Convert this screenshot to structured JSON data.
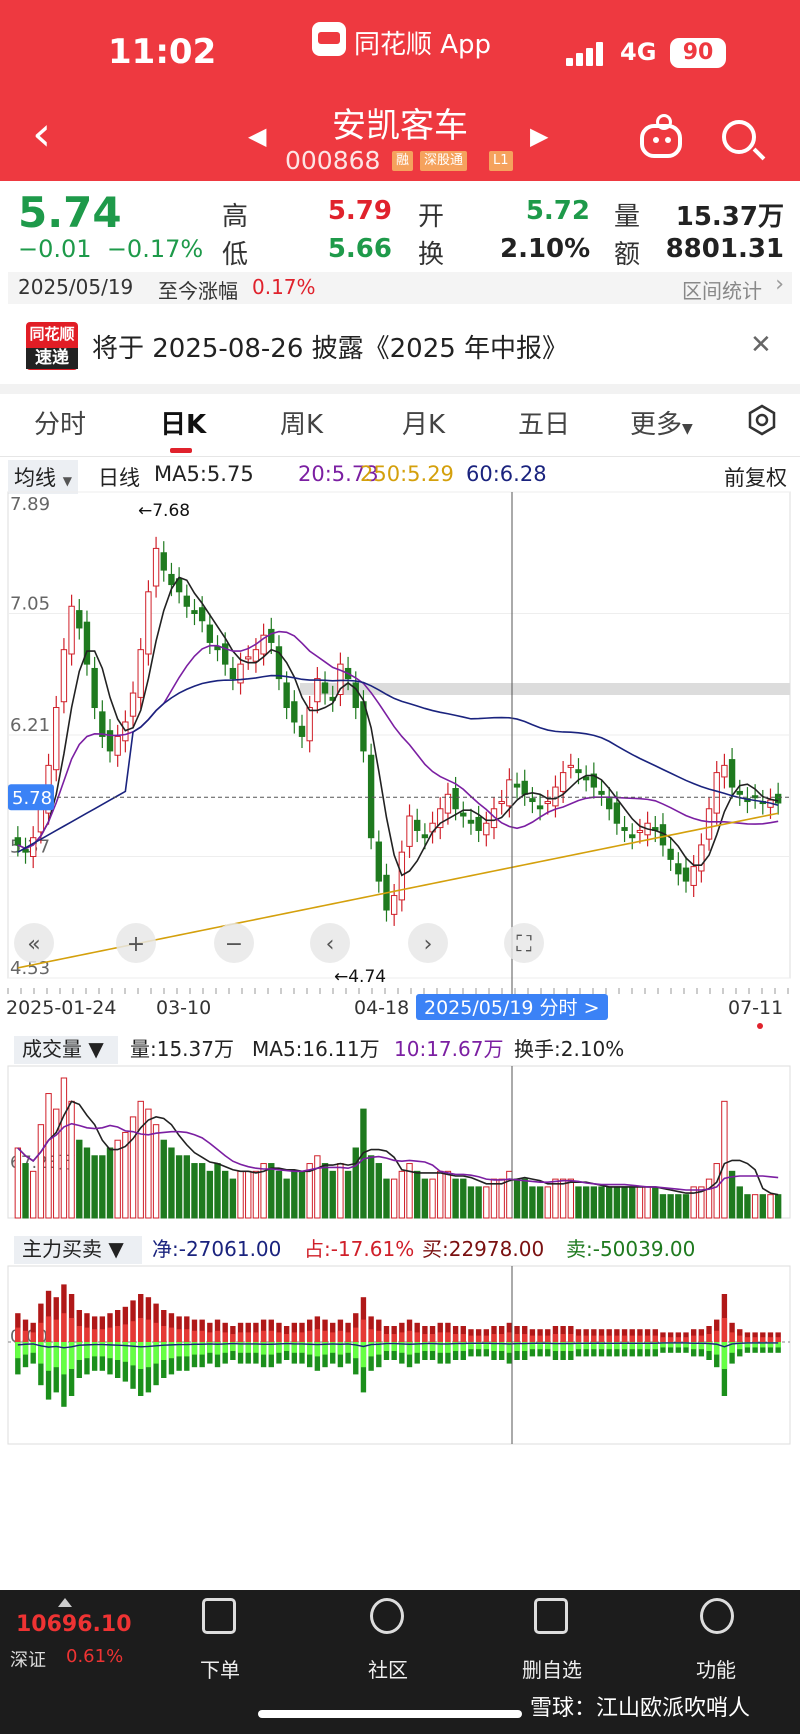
{
  "status_bar": {
    "time": "11:02",
    "app_name": "同花顺 App",
    "network": "4G",
    "battery": "90"
  },
  "header": {
    "back_icon": "back-chevron-icon",
    "stock_name": "安凯客车",
    "stock_code": "000868",
    "tags": [
      "融",
      "深股通",
      "L1"
    ]
  },
  "quote": {
    "price": "5.74",
    "change": "−0.01",
    "change_pct": "−0.17%",
    "high_label": "高",
    "high": "5.79",
    "low_label": "低",
    "low": "5.66",
    "open_label": "开",
    "open": "5.72",
    "turnover_label": "换",
    "turnover": "2.10%",
    "volume_label": "量",
    "volume": "15.37万",
    "amount_label": "额",
    "amount": "8801.31万",
    "date": "2025/05/19",
    "range_label": "至今涨幅",
    "range_value": "0.17%",
    "stats_label": "区间统计"
  },
  "news": {
    "logo_top": "同花顺",
    "logo_bottom": "速递",
    "text": "将于 2025-08-26 披露《2025 年中报》"
  },
  "tabs": [
    "分时",
    "日K",
    "周K",
    "月K",
    "五日",
    "更多"
  ],
  "active_tab": "日K",
  "ma_bar": {
    "type": "均线",
    "period": "日线",
    "ma5": "MA5:5.75",
    "ma20": "20:5.73",
    "ma250": "250:5.29",
    "ma60": "60:6.28",
    "adjust": "前复权"
  },
  "chart_data": [
    {
      "type": "candlestick",
      "title": "日K",
      "y_ticks": [
        "7.89",
        "7.05",
        "6.21",
        "5.37",
        "4.53"
      ],
      "current_price_tag": "5.78",
      "annotations": [
        {
          "text": "←7.68",
          "price": 7.68
        },
        {
          "text": "←4.74",
          "price": 4.74
        }
      ],
      "x_labels": [
        "2025-01-24",
        "03-10",
        "04-18",
        "2025/05/19 分时 >",
        "07-11"
      ],
      "ylim": [
        4.53,
        7.89
      ],
      "closes": [
        5.45,
        5.4,
        5.5,
        5.7,
        6.0,
        6.4,
        6.8,
        7.1,
        6.95,
        6.7,
        6.4,
        6.2,
        6.1,
        6.2,
        6.3,
        6.5,
        6.8,
        7.2,
        7.5,
        7.35,
        7.25,
        7.2,
        7.1,
        7.05,
        7.0,
        6.85,
        6.8,
        6.7,
        6.6,
        6.7,
        6.75,
        6.8,
        6.9,
        6.85,
        6.6,
        6.4,
        6.3,
        6.2,
        6.4,
        6.6,
        6.5,
        6.45,
        6.7,
        6.6,
        6.4,
        6.1,
        5.5,
        5.2,
        5.0,
        5.1,
        5.4,
        5.65,
        5.55,
        5.5,
        5.6,
        5.7,
        5.8,
        5.7,
        5.65,
        5.6,
        5.55,
        5.6,
        5.7,
        5.75,
        5.9,
        5.85,
        5.8,
        5.75,
        5.7,
        5.75,
        5.85,
        5.95,
        6.0,
        5.95,
        5.9,
        5.85,
        5.8,
        5.7,
        5.6,
        5.55,
        5.5,
        5.55,
        5.6,
        5.55,
        5.45,
        5.35,
        5.25,
        5.2,
        5.3,
        5.45,
        5.7,
        5.95,
        6.0,
        5.85,
        5.8,
        5.75,
        5.78,
        5.74,
        5.76,
        5.74
      ],
      "volumes": [
        9,
        7,
        6,
        12,
        16,
        14,
        18,
        15,
        10,
        9,
        8,
        8,
        9,
        10,
        11,
        13,
        15,
        14,
        12,
        10,
        9,
        8,
        8,
        7,
        7,
        6,
        7,
        6,
        5,
        6,
        6,
        6,
        7,
        7,
        6,
        5,
        6,
        6,
        7,
        8,
        7,
        6,
        7,
        6,
        9,
        14,
        8,
        7,
        5,
        5,
        6,
        7,
        6,
        5,
        5,
        6,
        6,
        5,
        5,
        4,
        4,
        4,
        5,
        5,
        6,
        5,
        5,
        4,
        4,
        4,
        5,
        5,
        5,
        4,
        4,
        4,
        4,
        4,
        4,
        4,
        4,
        4,
        4,
        4,
        3,
        3,
        3,
        3,
        4,
        4,
        5,
        7,
        15,
        6,
        4,
        3,
        3,
        3,
        3,
        3
      ],
      "volume_labels": {
        "type": "成交量",
        "volume": "量:15.37万",
        "ma5": "MA5:16.11万",
        "ma10": "10:17.67万",
        "turnover": "换手:2.10%",
        "y_tick": "67.23万"
      },
      "flow_labels": {
        "type": "主力买卖",
        "net": "净:-27061.00",
        "ratio": "占:-17.61%",
        "buy": "买:22978.00",
        "sell": "卖:-50039.00",
        "y_tick": "0.00"
      }
    }
  ],
  "bottom_nav": {
    "index_value": "10696.10",
    "index_name": "深证",
    "index_pct": "0.61%",
    "items": [
      {
        "label": "下单",
        "icon": "order-icon"
      },
      {
        "label": "社区",
        "icon": "community-icon"
      },
      {
        "label": "删自选",
        "icon": "remove-watchlist-icon"
      },
      {
        "label": "功能",
        "icon": "menu-icon"
      }
    ],
    "watermark": "雪球：江山欧派吹哨人"
  }
}
